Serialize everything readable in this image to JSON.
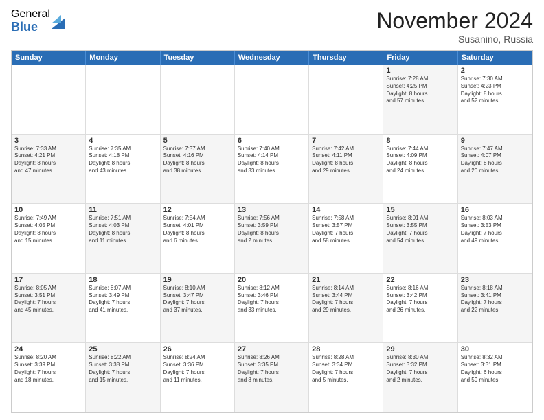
{
  "logo": {
    "general": "General",
    "blue": "Blue"
  },
  "title": "November 2024",
  "location": "Susanino, Russia",
  "days_of_week": [
    "Sunday",
    "Monday",
    "Tuesday",
    "Wednesday",
    "Thursday",
    "Friday",
    "Saturday"
  ],
  "weeks": [
    [
      {
        "day": "",
        "info": "",
        "shaded": false,
        "empty": true
      },
      {
        "day": "",
        "info": "",
        "shaded": false,
        "empty": true
      },
      {
        "day": "",
        "info": "",
        "shaded": false,
        "empty": true
      },
      {
        "day": "",
        "info": "",
        "shaded": false,
        "empty": true
      },
      {
        "day": "",
        "info": "",
        "shaded": false,
        "empty": true
      },
      {
        "day": "1",
        "info": "Sunrise: 7:28 AM\nSunset: 4:25 PM\nDaylight: 8 hours\nand 57 minutes.",
        "shaded": true
      },
      {
        "day": "2",
        "info": "Sunrise: 7:30 AM\nSunset: 4:23 PM\nDaylight: 8 hours\nand 52 minutes.",
        "shaded": false
      }
    ],
    [
      {
        "day": "3",
        "info": "Sunrise: 7:33 AM\nSunset: 4:21 PM\nDaylight: 8 hours\nand 47 minutes.",
        "shaded": true
      },
      {
        "day": "4",
        "info": "Sunrise: 7:35 AM\nSunset: 4:18 PM\nDaylight: 8 hours\nand 43 minutes.",
        "shaded": false
      },
      {
        "day": "5",
        "info": "Sunrise: 7:37 AM\nSunset: 4:16 PM\nDaylight: 8 hours\nand 38 minutes.",
        "shaded": true
      },
      {
        "day": "6",
        "info": "Sunrise: 7:40 AM\nSunset: 4:14 PM\nDaylight: 8 hours\nand 33 minutes.",
        "shaded": false
      },
      {
        "day": "7",
        "info": "Sunrise: 7:42 AM\nSunset: 4:11 PM\nDaylight: 8 hours\nand 29 minutes.",
        "shaded": true
      },
      {
        "day": "8",
        "info": "Sunrise: 7:44 AM\nSunset: 4:09 PM\nDaylight: 8 hours\nand 24 minutes.",
        "shaded": false
      },
      {
        "day": "9",
        "info": "Sunrise: 7:47 AM\nSunset: 4:07 PM\nDaylight: 8 hours\nand 20 minutes.",
        "shaded": true
      }
    ],
    [
      {
        "day": "10",
        "info": "Sunrise: 7:49 AM\nSunset: 4:05 PM\nDaylight: 8 hours\nand 15 minutes.",
        "shaded": false
      },
      {
        "day": "11",
        "info": "Sunrise: 7:51 AM\nSunset: 4:03 PM\nDaylight: 8 hours\nand 11 minutes.",
        "shaded": true
      },
      {
        "day": "12",
        "info": "Sunrise: 7:54 AM\nSunset: 4:01 PM\nDaylight: 8 hours\nand 6 minutes.",
        "shaded": false
      },
      {
        "day": "13",
        "info": "Sunrise: 7:56 AM\nSunset: 3:59 PM\nDaylight: 8 hours\nand 2 minutes.",
        "shaded": true
      },
      {
        "day": "14",
        "info": "Sunrise: 7:58 AM\nSunset: 3:57 PM\nDaylight: 7 hours\nand 58 minutes.",
        "shaded": false
      },
      {
        "day": "15",
        "info": "Sunrise: 8:01 AM\nSunset: 3:55 PM\nDaylight: 7 hours\nand 54 minutes.",
        "shaded": true
      },
      {
        "day": "16",
        "info": "Sunrise: 8:03 AM\nSunset: 3:53 PM\nDaylight: 7 hours\nand 49 minutes.",
        "shaded": false
      }
    ],
    [
      {
        "day": "17",
        "info": "Sunrise: 8:05 AM\nSunset: 3:51 PM\nDaylight: 7 hours\nand 45 minutes.",
        "shaded": true
      },
      {
        "day": "18",
        "info": "Sunrise: 8:07 AM\nSunset: 3:49 PM\nDaylight: 7 hours\nand 41 minutes.",
        "shaded": false
      },
      {
        "day": "19",
        "info": "Sunrise: 8:10 AM\nSunset: 3:47 PM\nDaylight: 7 hours\nand 37 minutes.",
        "shaded": true
      },
      {
        "day": "20",
        "info": "Sunrise: 8:12 AM\nSunset: 3:46 PM\nDaylight: 7 hours\nand 33 minutes.",
        "shaded": false
      },
      {
        "day": "21",
        "info": "Sunrise: 8:14 AM\nSunset: 3:44 PM\nDaylight: 7 hours\nand 29 minutes.",
        "shaded": true
      },
      {
        "day": "22",
        "info": "Sunrise: 8:16 AM\nSunset: 3:42 PM\nDaylight: 7 hours\nand 26 minutes.",
        "shaded": false
      },
      {
        "day": "23",
        "info": "Sunrise: 8:18 AM\nSunset: 3:41 PM\nDaylight: 7 hours\nand 22 minutes.",
        "shaded": true
      }
    ],
    [
      {
        "day": "24",
        "info": "Sunrise: 8:20 AM\nSunset: 3:39 PM\nDaylight: 7 hours\nand 18 minutes.",
        "shaded": false
      },
      {
        "day": "25",
        "info": "Sunrise: 8:22 AM\nSunset: 3:38 PM\nDaylight: 7 hours\nand 15 minutes.",
        "shaded": true
      },
      {
        "day": "26",
        "info": "Sunrise: 8:24 AM\nSunset: 3:36 PM\nDaylight: 7 hours\nand 11 minutes.",
        "shaded": false
      },
      {
        "day": "27",
        "info": "Sunrise: 8:26 AM\nSunset: 3:35 PM\nDaylight: 7 hours\nand 8 minutes.",
        "shaded": true
      },
      {
        "day": "28",
        "info": "Sunrise: 8:28 AM\nSunset: 3:34 PM\nDaylight: 7 hours\nand 5 minutes.",
        "shaded": false
      },
      {
        "day": "29",
        "info": "Sunrise: 8:30 AM\nSunset: 3:32 PM\nDaylight: 7 hours\nand 2 minutes.",
        "shaded": true
      },
      {
        "day": "30",
        "info": "Sunrise: 8:32 AM\nSunset: 3:31 PM\nDaylight: 6 hours\nand 59 minutes.",
        "shaded": false
      }
    ]
  ]
}
